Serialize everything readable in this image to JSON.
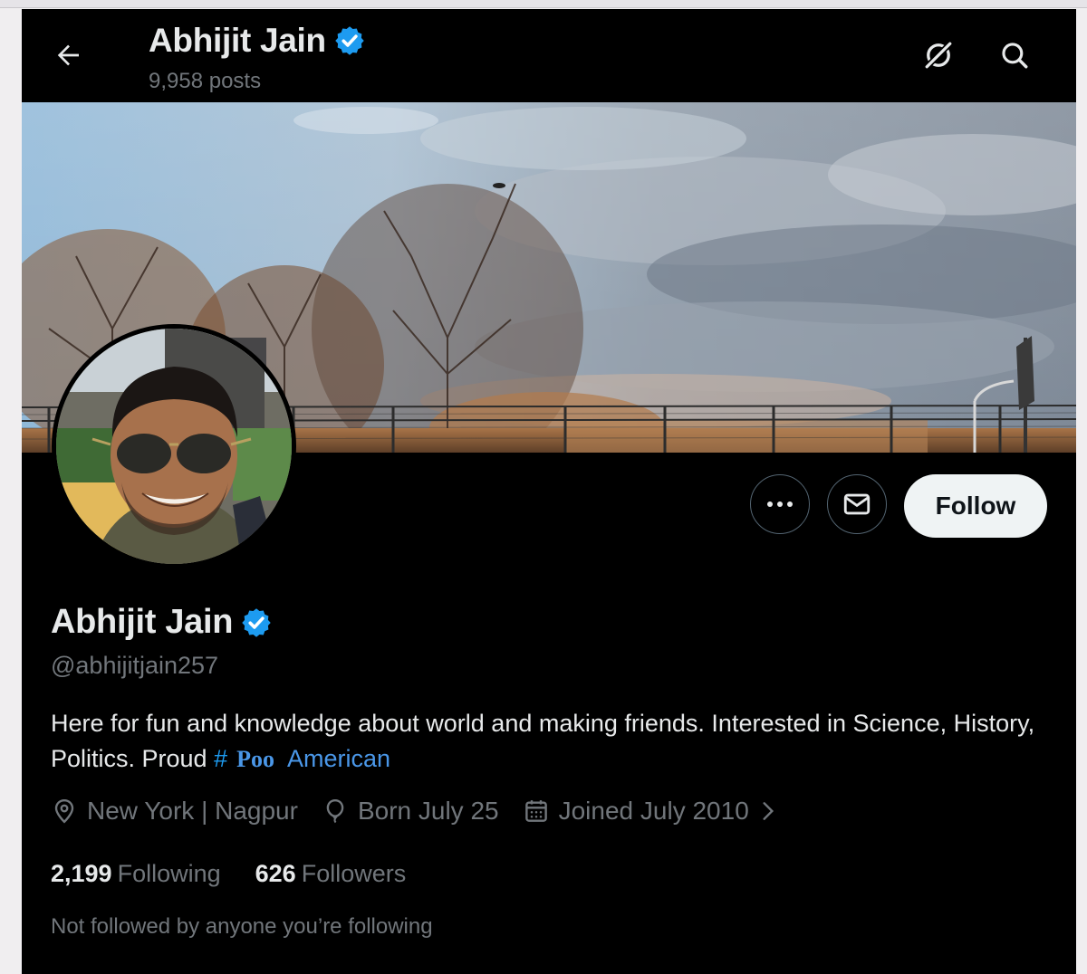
{
  "header": {
    "name": "Abhijit Jain",
    "posts": "9,958 posts"
  },
  "icons": {
    "back": "arrow-left-icon",
    "grok": "grok-icon",
    "search": "search-icon",
    "verified": "verified-badge-icon",
    "more": "more-dots-icon",
    "message": "envelope-icon",
    "location": "location-pin-icon",
    "birthday": "balloon-icon",
    "joined": "calendar-icon",
    "chevron": "chevron-right-icon"
  },
  "profile": {
    "name": "Abhijit Jain",
    "handle": "@abhijitjain257",
    "bio_text": "Here for fun and knowledge about world and making friends. Interested in Science, History, Politics.  Proud",
    "bio_hash": "#",
    "bio_poo": "Poo",
    "bio_american": "American",
    "location": "New York | Nagpur",
    "born": "Born July 25",
    "joined": "Joined July 2010",
    "following_count": "2,199",
    "following_label": "Following",
    "followers_count": "626",
    "followers_label": "Followers",
    "not_followed": "Not followed by anyone you’re following"
  },
  "actions": {
    "follow_label": "Follow"
  },
  "colors": {
    "background": "#000000",
    "accent": "#1d9bf0",
    "secondary_text": "#71767b",
    "follow_bg": "#eff3f4"
  }
}
